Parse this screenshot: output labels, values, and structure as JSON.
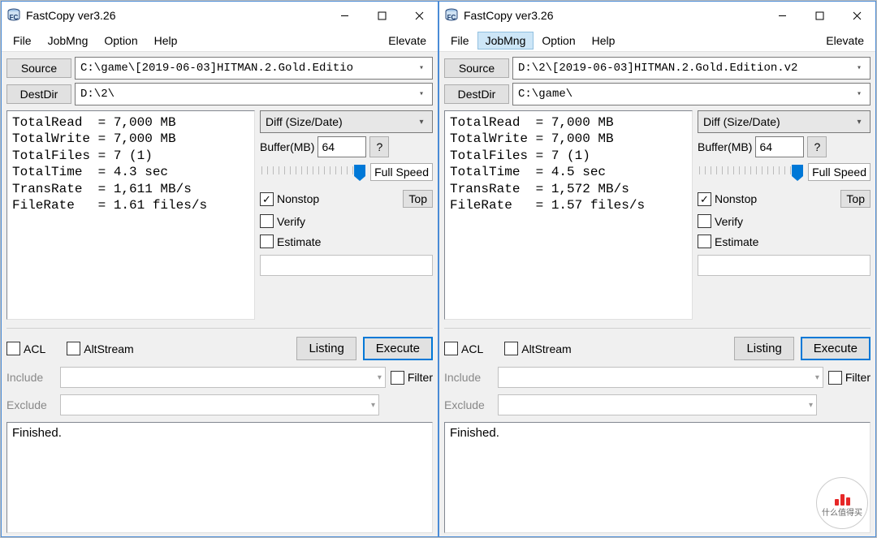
{
  "app": {
    "title": "FastCopy ver3.26"
  },
  "menu": {
    "file": "File",
    "jobmng": "JobMng",
    "option": "Option",
    "help": "Help",
    "elevate": "Elevate"
  },
  "labels": {
    "source": "Source",
    "destdir": "DestDir",
    "diff_mode": "Diff (Size/Date)",
    "buffer": "Buffer(MB)",
    "help_q": "?",
    "fullspeed": "Full Speed",
    "nonstop": "Nonstop",
    "verify": "Verify",
    "estimate": "Estimate",
    "top": "Top",
    "acl": "ACL",
    "altstream": "AltStream",
    "listing": "Listing",
    "execute": "Execute",
    "include": "Include",
    "exclude": "Exclude",
    "filter": "Filter"
  },
  "windows": [
    {
      "source": "C:\\game\\[2019-06-03]HITMAN.2.Gold.Editio",
      "dest": "D:\\2\\",
      "buffer": "64",
      "nonstop": true,
      "verify": false,
      "estimate": false,
      "acl": false,
      "altstream": false,
      "filter": false,
      "status": "Finished.",
      "jobmng_hover": false,
      "stats_text": "TotalRead  = 7,000 MB\nTotalWrite = 7,000 MB\nTotalFiles = 7 (1)\nTotalTime  = 4.3 sec\nTransRate  = 1,611 MB/s\nFileRate   = 1.61 files/s"
    },
    {
      "source": "D:\\2\\[2019-06-03]HITMAN.2.Gold.Edition.v2",
      "dest": "C:\\game\\",
      "buffer": "64",
      "nonstop": true,
      "verify": false,
      "estimate": false,
      "acl": false,
      "altstream": false,
      "filter": false,
      "status": "Finished.",
      "jobmng_hover": true,
      "stats_text": "TotalRead  = 7,000 MB\nTotalWrite = 7,000 MB\nTotalFiles = 7 (1)\nTotalTime  = 4.5 sec\nTransRate  = 1,572 MB/s\nFileRate   = 1.57 files/s"
    }
  ],
  "watermark": "什么值得买"
}
